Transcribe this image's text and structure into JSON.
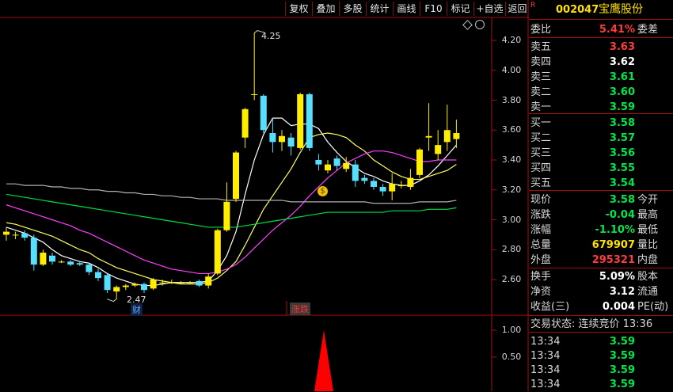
{
  "toolbar": {
    "buttons": [
      "复权",
      "叠加",
      "多股",
      "统计",
      "画线",
      "F10",
      "标记",
      "+自选",
      "返回"
    ]
  },
  "price_axis": [
    "4.20",
    "4.00",
    "3.80",
    "3.60",
    "3.40",
    "3.20",
    "3.00",
    "2.80",
    "2.60"
  ],
  "vol_axis": [
    "1.00",
    "0.50"
  ],
  "chart_labels": {
    "high": "4.25",
    "low": "2.47",
    "cai_badge": "财",
    "zhangdie": "涨跌"
  },
  "chart_data": {
    "type": "candlestick",
    "ylim": [
      2.47,
      4.25
    ],
    "candles": [
      {
        "o": 2.9,
        "c": 2.92,
        "h": 2.95,
        "l": 2.86
      },
      {
        "o": 2.9,
        "c": 2.9,
        "h": 2.92,
        "l": 2.87
      },
      {
        "o": 2.91,
        "c": 2.88,
        "h": 2.93,
        "l": 2.86
      },
      {
        "o": 2.88,
        "c": 2.7,
        "h": 2.9,
        "l": 2.66
      },
      {
        "o": 2.7,
        "c": 2.78,
        "h": 2.8,
        "l": 2.69
      },
      {
        "o": 2.76,
        "c": 2.72,
        "h": 2.78,
        "l": 2.7
      },
      {
        "o": 2.72,
        "c": 2.72,
        "h": 2.73,
        "l": 2.71
      },
      {
        "o": 2.72,
        "c": 2.7,
        "h": 2.73,
        "l": 2.69
      },
      {
        "o": 2.71,
        "c": 2.7,
        "h": 2.72,
        "l": 2.69
      },
      {
        "o": 2.7,
        "c": 2.65,
        "h": 2.71,
        "l": 2.63
      },
      {
        "o": 2.65,
        "c": 2.61,
        "h": 2.67,
        "l": 2.59
      },
      {
        "o": 2.63,
        "c": 2.53,
        "h": 2.64,
        "l": 2.51
      },
      {
        "o": 2.52,
        "c": 2.55,
        "h": 2.56,
        "l": 2.47
      },
      {
        "o": 2.55,
        "c": 2.56,
        "h": 2.57,
        "l": 2.53
      },
      {
        "o": 2.56,
        "c": 2.57,
        "h": 2.58,
        "l": 2.55
      },
      {
        "o": 2.57,
        "c": 2.53,
        "h": 2.58,
        "l": 2.51
      },
      {
        "o": 2.54,
        "c": 2.6,
        "h": 2.61,
        "l": 2.53
      },
      {
        "o": 2.58,
        "c": 2.58,
        "h": 2.6,
        "l": 2.56
      },
      {
        "o": 2.58,
        "c": 2.58,
        "h": 2.6,
        "l": 2.57
      },
      {
        "o": 2.58,
        "c": 2.58,
        "h": 2.59,
        "l": 2.57
      },
      {
        "o": 2.58,
        "c": 2.58,
        "h": 2.59,
        "l": 2.57
      },
      {
        "o": 2.59,
        "c": 2.56,
        "h": 2.6,
        "l": 2.55
      },
      {
        "o": 2.56,
        "c": 2.62,
        "h": 2.64,
        "l": 2.54
      },
      {
        "o": 2.64,
        "c": 2.93,
        "h": 2.94,
        "l": 2.63
      },
      {
        "o": 2.93,
        "c": 3.12,
        "h": 3.25,
        "l": 2.92
      },
      {
        "o": 3.14,
        "c": 3.45,
        "h": 3.46,
        "l": 3.12
      },
      {
        "o": 3.55,
        "c": 3.74,
        "h": 3.75,
        "l": 3.48
      },
      {
        "o": 3.84,
        "c": 3.84,
        "h": 4.25,
        "l": 3.8
      },
      {
        "o": 3.83,
        "c": 3.6,
        "h": 3.84,
        "l": 3.58
      },
      {
        "o": 3.58,
        "c": 3.52,
        "h": 3.68,
        "l": 3.45
      },
      {
        "o": 3.52,
        "c": 3.56,
        "h": 3.6,
        "l": 3.46
      },
      {
        "o": 3.55,
        "c": 3.49,
        "h": 3.58,
        "l": 3.43
      },
      {
        "o": 3.48,
        "c": 3.84,
        "h": 3.85,
        "l": 3.47
      },
      {
        "o": 3.84,
        "c": 3.48,
        "h": 3.85,
        "l": 3.46
      },
      {
        "o": 3.4,
        "c": 3.37,
        "h": 3.44,
        "l": 3.33
      },
      {
        "o": 3.33,
        "c": 3.37,
        "h": 3.4,
        "l": 3.31
      },
      {
        "o": 3.41,
        "c": 3.36,
        "h": 3.43,
        "l": 3.33
      },
      {
        "o": 3.34,
        "c": 3.38,
        "h": 3.42,
        "l": 3.32
      },
      {
        "o": 3.37,
        "c": 3.26,
        "h": 3.4,
        "l": 3.22
      },
      {
        "o": 3.28,
        "c": 3.26,
        "h": 3.3,
        "l": 3.24
      },
      {
        "o": 3.26,
        "c": 3.22,
        "h": 3.28,
        "l": 3.2
      },
      {
        "o": 3.22,
        "c": 3.19,
        "h": 3.24,
        "l": 3.16
      },
      {
        "o": 3.19,
        "c": 3.24,
        "h": 3.31,
        "l": 3.13
      },
      {
        "o": 3.23,
        "c": 3.23,
        "h": 3.26,
        "l": 3.21
      },
      {
        "o": 3.22,
        "c": 3.28,
        "h": 3.34,
        "l": 3.2
      },
      {
        "o": 3.3,
        "c": 3.47,
        "h": 3.48,
        "l": 3.28
      },
      {
        "o": 3.55,
        "c": 3.56,
        "h": 3.78,
        "l": 3.46
      },
      {
        "o": 3.44,
        "c": 3.5,
        "h": 3.6,
        "l": 3.4
      },
      {
        "o": 3.52,
        "c": 3.6,
        "h": 3.77,
        "l": 3.46
      },
      {
        "o": 3.54,
        "c": 3.58,
        "h": 3.67,
        "l": 3.48
      }
    ],
    "moving_averages": [
      {
        "name": "MA5",
        "color": "#ffffff",
        "values": [
          2.95,
          2.93,
          2.91,
          2.88,
          2.85,
          2.8,
          2.76,
          2.74,
          2.72,
          2.71,
          2.68,
          2.64,
          2.61,
          2.59,
          2.57,
          2.56,
          2.56,
          2.57,
          2.58,
          2.58,
          2.58,
          2.58,
          2.59,
          2.66,
          2.76,
          2.92,
          3.17,
          3.4,
          3.57,
          3.68,
          3.68,
          3.63,
          3.64,
          3.64,
          3.61,
          3.52,
          3.45,
          3.39,
          3.35,
          3.31,
          3.29,
          3.26,
          3.24,
          3.23,
          3.23,
          3.26,
          3.3,
          3.36,
          3.43,
          3.5
        ]
      },
      {
        "name": "MA10",
        "color": "#ffff60",
        "values": [
          2.98,
          2.97,
          2.95,
          2.93,
          2.91,
          2.89,
          2.86,
          2.83,
          2.8,
          2.78,
          2.74,
          2.71,
          2.68,
          2.66,
          2.64,
          2.62,
          2.6,
          2.59,
          2.58,
          2.57,
          2.57,
          2.57,
          2.58,
          2.61,
          2.66,
          2.72,
          2.83,
          2.95,
          3.07,
          3.16,
          3.25,
          3.34,
          3.45,
          3.55,
          3.57,
          3.58,
          3.57,
          3.55,
          3.5,
          3.46,
          3.4,
          3.36,
          3.32,
          3.29,
          3.27,
          3.27,
          3.29,
          3.31,
          3.33,
          3.37
        ]
      },
      {
        "name": "MA20",
        "color": "#ff40ff",
        "values": [
          3.1,
          3.08,
          3.06,
          3.04,
          3.02,
          3.0,
          2.98,
          2.96,
          2.93,
          2.91,
          2.88,
          2.85,
          2.82,
          2.79,
          2.76,
          2.73,
          2.71,
          2.69,
          2.67,
          2.66,
          2.65,
          2.64,
          2.64,
          2.65,
          2.67,
          2.7,
          2.75,
          2.81,
          2.87,
          2.93,
          2.98,
          3.03,
          3.09,
          3.16,
          3.22,
          3.28,
          3.33,
          3.38,
          3.41,
          3.44,
          3.46,
          3.46,
          3.45,
          3.43,
          3.41,
          3.39,
          3.39,
          3.4,
          3.4,
          3.4
        ]
      },
      {
        "name": "MA60",
        "color": "#00e040",
        "values": [
          3.17,
          3.16,
          3.15,
          3.14,
          3.13,
          3.12,
          3.11,
          3.1,
          3.09,
          3.08,
          3.07,
          3.06,
          3.05,
          3.04,
          3.03,
          3.02,
          3.01,
          3.0,
          2.99,
          2.98,
          2.97,
          2.96,
          2.95,
          2.95,
          2.95,
          2.95,
          2.96,
          2.97,
          2.98,
          2.99,
          3.0,
          3.01,
          3.02,
          3.03,
          3.04,
          3.05,
          3.05,
          3.05,
          3.05,
          3.05,
          3.05,
          3.05,
          3.06,
          3.06,
          3.06,
          3.06,
          3.07,
          3.07,
          3.07,
          3.08
        ]
      },
      {
        "name": "MA120",
        "color": "#b0b0b0",
        "values": [
          3.24,
          3.24,
          3.23,
          3.23,
          3.23,
          3.22,
          3.22,
          3.21,
          3.21,
          3.2,
          3.2,
          3.19,
          3.19,
          3.18,
          3.18,
          3.17,
          3.17,
          3.16,
          3.16,
          3.15,
          3.15,
          3.14,
          3.14,
          3.14,
          3.13,
          3.13,
          3.13,
          3.13,
          3.13,
          3.13,
          3.13,
          3.12,
          3.12,
          3.12,
          3.12,
          3.12,
          3.12,
          3.12,
          3.12,
          3.12,
          3.11,
          3.11,
          3.11,
          3.11,
          3.11,
          3.12,
          3.12,
          3.12,
          3.12,
          3.13
        ]
      }
    ],
    "indicator": {
      "name": "涨跌",
      "ylim": [
        0,
        1.2
      ],
      "spike_value": 1.0
    }
  },
  "quote": {
    "code": "002047",
    "name": "宝鹰股份",
    "weibi_label": "委比",
    "weibi_value": "5.41%",
    "weicha_label": "委差",
    "asks": [
      {
        "label": "卖五",
        "price": "3.63"
      },
      {
        "label": "卖四",
        "price": "3.62"
      },
      {
        "label": "卖三",
        "price": "3.61"
      },
      {
        "label": "卖二",
        "price": "3.60"
      },
      {
        "label": "卖一",
        "price": "3.59"
      }
    ],
    "bids": [
      {
        "label": "买一",
        "price": "3.58"
      },
      {
        "label": "买二",
        "price": "3.57"
      },
      {
        "label": "买三",
        "price": "3.56"
      },
      {
        "label": "买四",
        "price": "3.55"
      },
      {
        "label": "买五",
        "price": "3.54"
      }
    ],
    "stats": [
      {
        "label": "现价",
        "value": "3.58",
        "label2": "今开"
      },
      {
        "label": "涨跌",
        "value": "-0.04",
        "label2": "最高"
      },
      {
        "label": "涨幅",
        "value": "-1.10%",
        "label2": "最低"
      },
      {
        "label": "总量",
        "value": "679907",
        "label2": "量比"
      },
      {
        "label": "外盘",
        "value": "295321",
        "label2": "内盘"
      },
      {
        "label": "换手",
        "value": "5.09%",
        "label2": "股本"
      },
      {
        "label": "净资",
        "value": "3.12",
        "label2": "流通"
      },
      {
        "label": "收益(三)",
        "value": "0.004",
        "label2": "PE(动)"
      }
    ],
    "trade_status": "交易状态: 连续竞价 13:36",
    "ticks": [
      {
        "time": "13:34",
        "price": "3.59"
      },
      {
        "time": "13:34",
        "price": "3.59"
      },
      {
        "time": "13:34",
        "price": "3.59"
      },
      {
        "time": "13:34",
        "price": "3.59"
      }
    ]
  },
  "colors": {
    "up": "#ffee00",
    "down": "#55e0ff",
    "frame": "#a01010",
    "bg": "#000000"
  }
}
